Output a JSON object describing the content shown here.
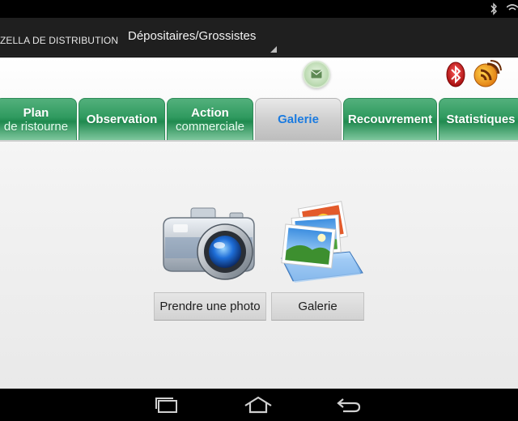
{
  "status_bar": {
    "icons": [
      "bluetooth-icon",
      "wifi-icon"
    ]
  },
  "action_bar": {
    "app_title": "ZELLA DE DISTRIBUTION",
    "spinner_value": "Dépositaires/Grossistes"
  },
  "toolbar_icons": [
    "mail-icon",
    "bluetooth-icon",
    "rss-icon"
  ],
  "tabs": [
    {
      "line1": "Plan",
      "line2": "de ristourne"
    },
    {
      "line1": "Observation",
      "line2": ""
    },
    {
      "line1": "Action",
      "line2": "commerciale"
    },
    {
      "line1": "Galerie",
      "line2": ""
    },
    {
      "line1": "Recouvrement",
      "line2": ""
    },
    {
      "line1": "Statistiques",
      "line2": ""
    }
  ],
  "active_tab": "Galerie",
  "gallery": {
    "take_photo_label": "Prendre une photo",
    "gallery_label": "Galerie",
    "icons": [
      "camera-icon",
      "photo-gallery-icon"
    ]
  },
  "nav_bar": {
    "icons": [
      "recent-apps-icon",
      "home-icon",
      "back-icon"
    ]
  },
  "colors": {
    "tab_green": "#2f9a5f",
    "active_tab_text": "#1b7be0",
    "action_bar": "#1f1f1f"
  }
}
